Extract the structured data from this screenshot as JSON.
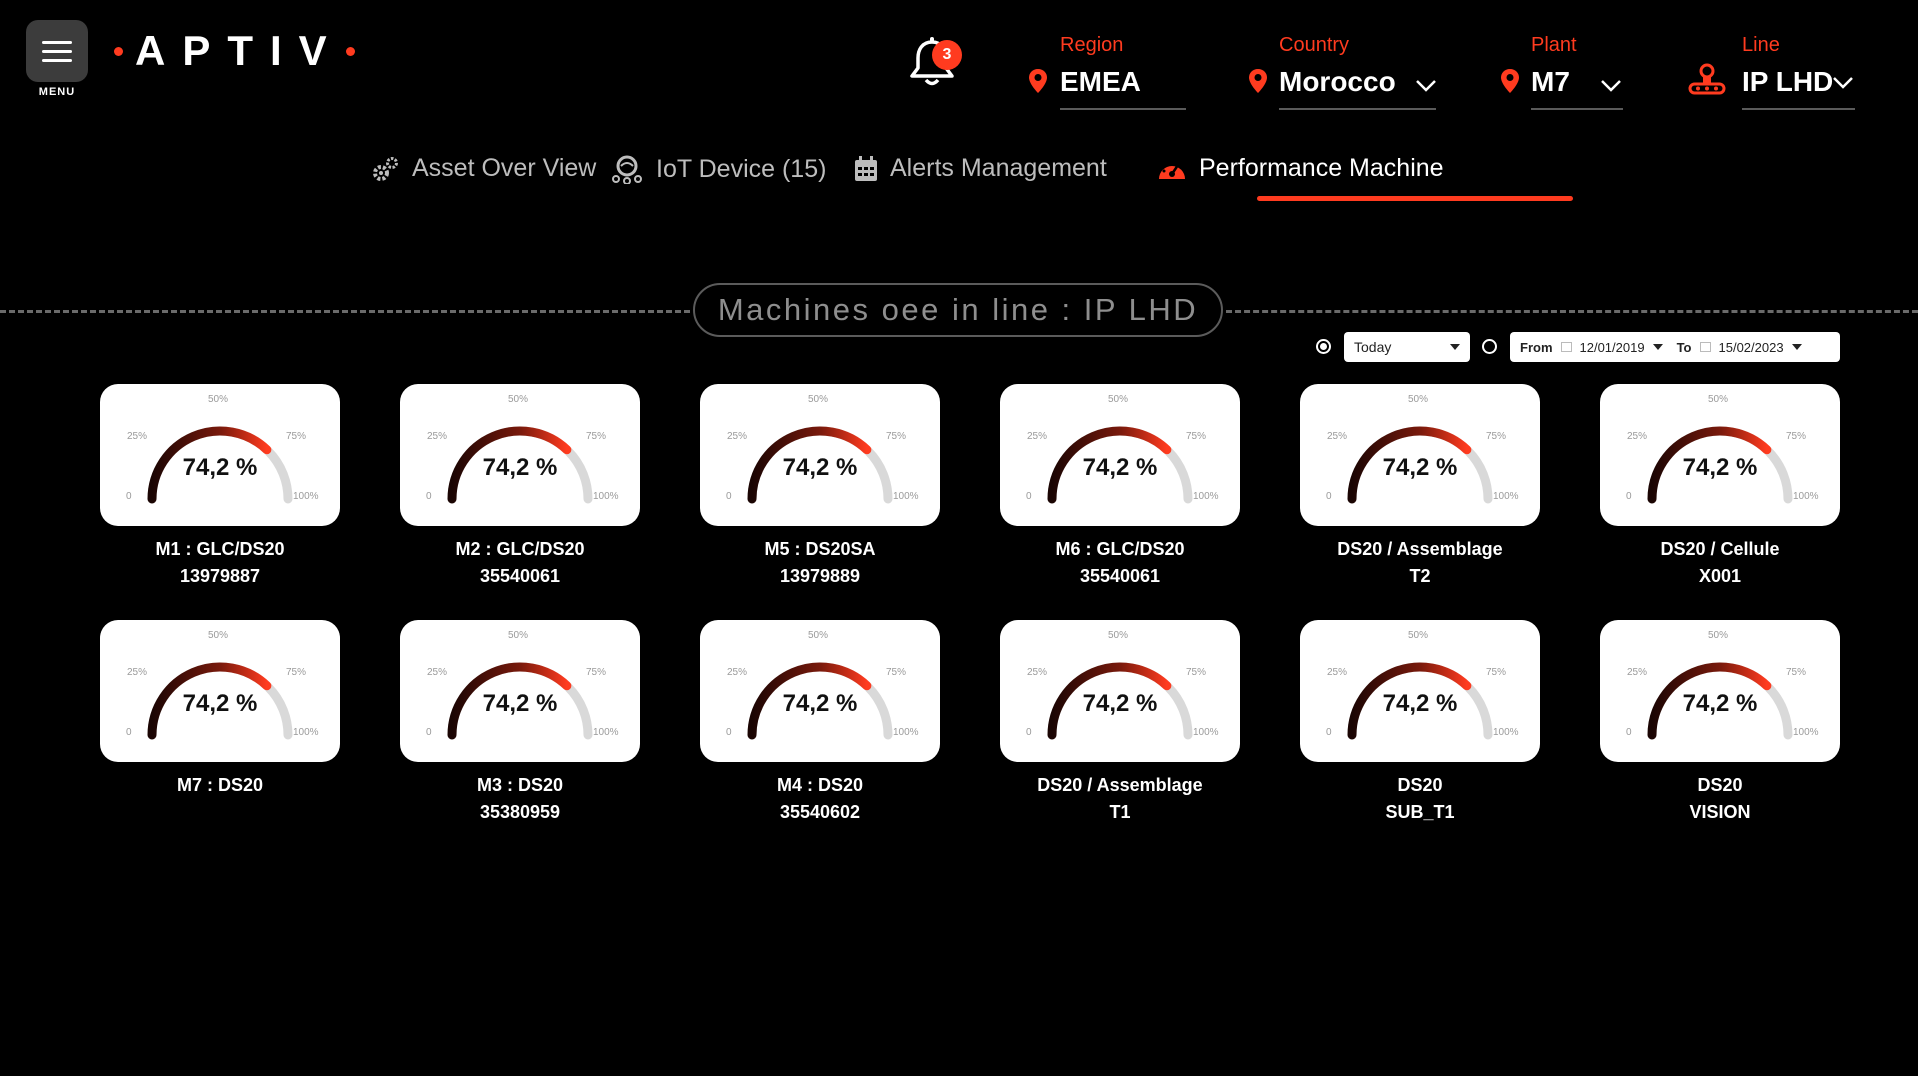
{
  "header": {
    "menu_label": "MENU",
    "logo_text": "APTIV",
    "notifications": {
      "count": "3",
      "icon": "bell-icon"
    },
    "filters": [
      {
        "label": "Region",
        "value": "EMEA",
        "icon": "location-pin-icon",
        "has_dropdown": false
      },
      {
        "label": "Country",
        "value": "Morocco",
        "icon": "location-pin-icon",
        "has_dropdown": true
      },
      {
        "label": "Plant",
        "value": "M7",
        "icon": "location-pin-icon",
        "has_dropdown": true
      },
      {
        "label": "Line",
        "value": "IP LHD",
        "icon": "production-line-icon",
        "has_dropdown": true
      }
    ]
  },
  "tabs": [
    {
      "label": "Asset Over View",
      "icon": "gears-icon",
      "active": false
    },
    {
      "label": "IoT Device (15)",
      "icon": "iot-device-icon",
      "active": false
    },
    {
      "label": "Alerts Management",
      "icon": "calendar-icon",
      "active": false
    },
    {
      "label": "Performance Machine",
      "icon": "speedometer-icon",
      "active": true
    }
  ],
  "section": {
    "title": "Machines oee in line : IP LHD"
  },
  "date_filter": {
    "mode": "today",
    "today_option": "Today",
    "from_label": "From",
    "from_value": "12/01/2019",
    "to_label": "To",
    "to_value": "15/02/2023"
  },
  "gauge_ticks": {
    "t0": "0",
    "t25": "25%",
    "t50": "50%",
    "t75": "75%",
    "t100": "100%"
  },
  "colors": {
    "accent": "#ff3b1f",
    "gauge_dark": "#1a0503",
    "gauge_track": "#d9d9d9"
  },
  "machines": [
    {
      "line1": "M1 : GLC/DS20",
      "line2": "13979887",
      "oee_label": "74,2 %",
      "oee": 74.2
    },
    {
      "line1": "M2 : GLC/DS20",
      "line2": "35540061",
      "oee_label": "74,2 %",
      "oee": 74.2
    },
    {
      "line1": "M5 : DS20SA",
      "line2": "13979889",
      "oee_label": "74,2 %",
      "oee": 74.2
    },
    {
      "line1": "M6 : GLC/DS20",
      "line2": "35540061",
      "oee_label": "74,2 %",
      "oee": 74.2
    },
    {
      "line1": "DS20 / Assemblage",
      "line2": "T2",
      "oee_label": "74,2 %",
      "oee": 74.2
    },
    {
      "line1": "DS20 / Cellule",
      "line2": "X001",
      "oee_label": "74,2 %",
      "oee": 74.2
    },
    {
      "line1": "M7 : DS20",
      "line2": "",
      "oee_label": "74,2 %",
      "oee": 74.2
    },
    {
      "line1": "M3 : DS20",
      "line2": "35380959",
      "oee_label": "74,2 %",
      "oee": 74.2
    },
    {
      "line1": "M4 : DS20",
      "line2": "35540602",
      "oee_label": "74,2 %",
      "oee": 74.2
    },
    {
      "line1": "DS20 / Assemblage",
      "line2": "T1",
      "oee_label": "74,2 %",
      "oee": 74.2
    },
    {
      "line1": "DS20",
      "line2": "SUB_T1",
      "oee_label": "74,2 %",
      "oee": 74.2
    },
    {
      "line1": "DS20",
      "line2": "VISION",
      "oee_label": "74,2 %",
      "oee": 74.2
    }
  ]
}
